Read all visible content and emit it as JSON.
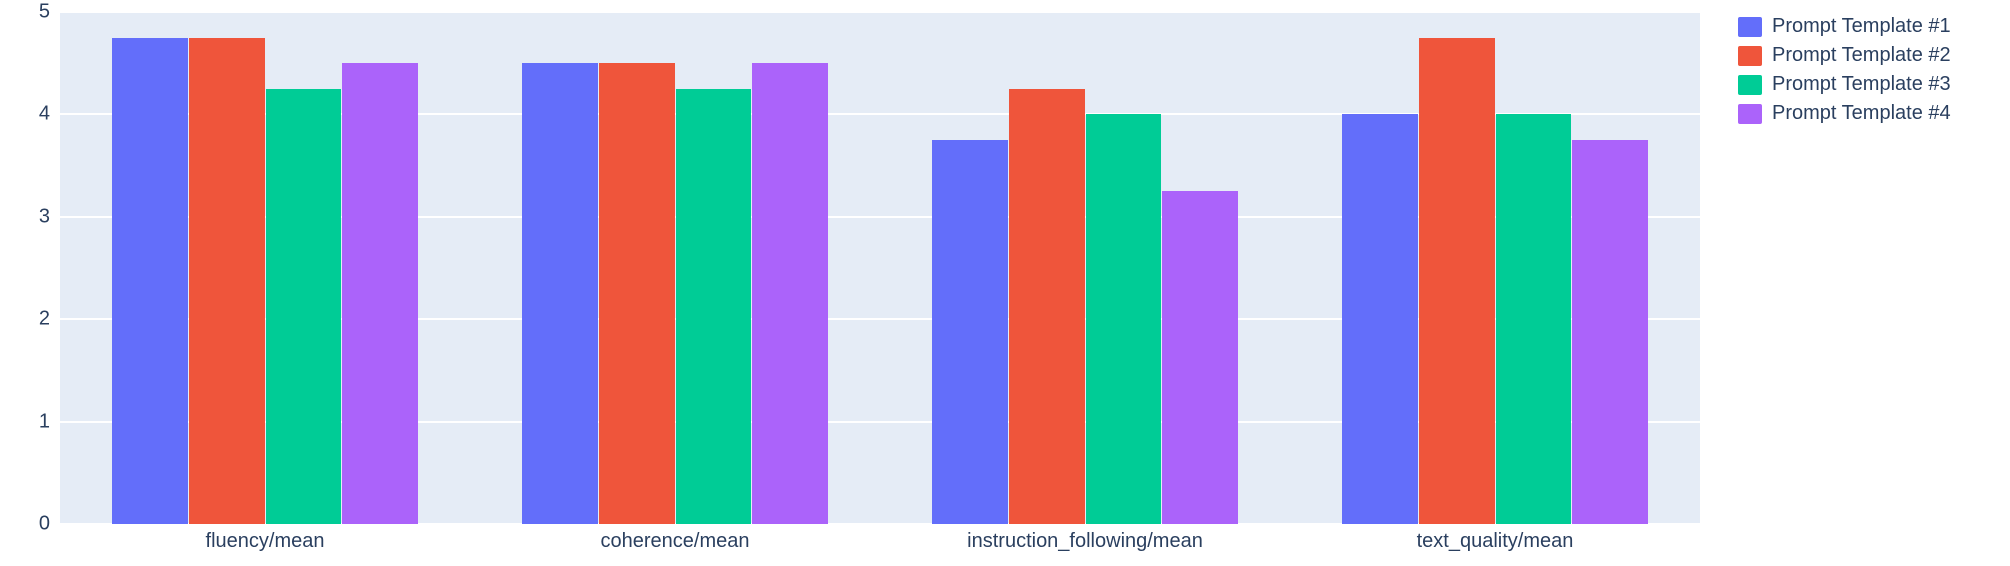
{
  "chart_data": {
    "type": "bar",
    "categories": [
      "fluency/mean",
      "coherence/mean",
      "instruction_following/mean",
      "text_quality/mean"
    ],
    "series": [
      {
        "name": "Prompt Template #1",
        "color": "#636efa",
        "values": [
          4.75,
          4.5,
          3.75,
          4.0
        ]
      },
      {
        "name": "Prompt Template #2",
        "color": "#ef553b",
        "values": [
          4.75,
          4.5,
          4.25,
          4.75
        ]
      },
      {
        "name": "Prompt Template #3",
        "color": "#00cc96",
        "values": [
          4.25,
          4.25,
          4.0,
          4.0
        ]
      },
      {
        "name": "Prompt Template #4",
        "color": "#ab63fa",
        "values": [
          4.5,
          4.5,
          3.25,
          3.75
        ]
      }
    ],
    "ylim": [
      0,
      5
    ],
    "yticks": [
      0,
      1,
      2,
      3,
      4,
      5
    ],
    "title": "",
    "xlabel": "",
    "ylabel": ""
  }
}
